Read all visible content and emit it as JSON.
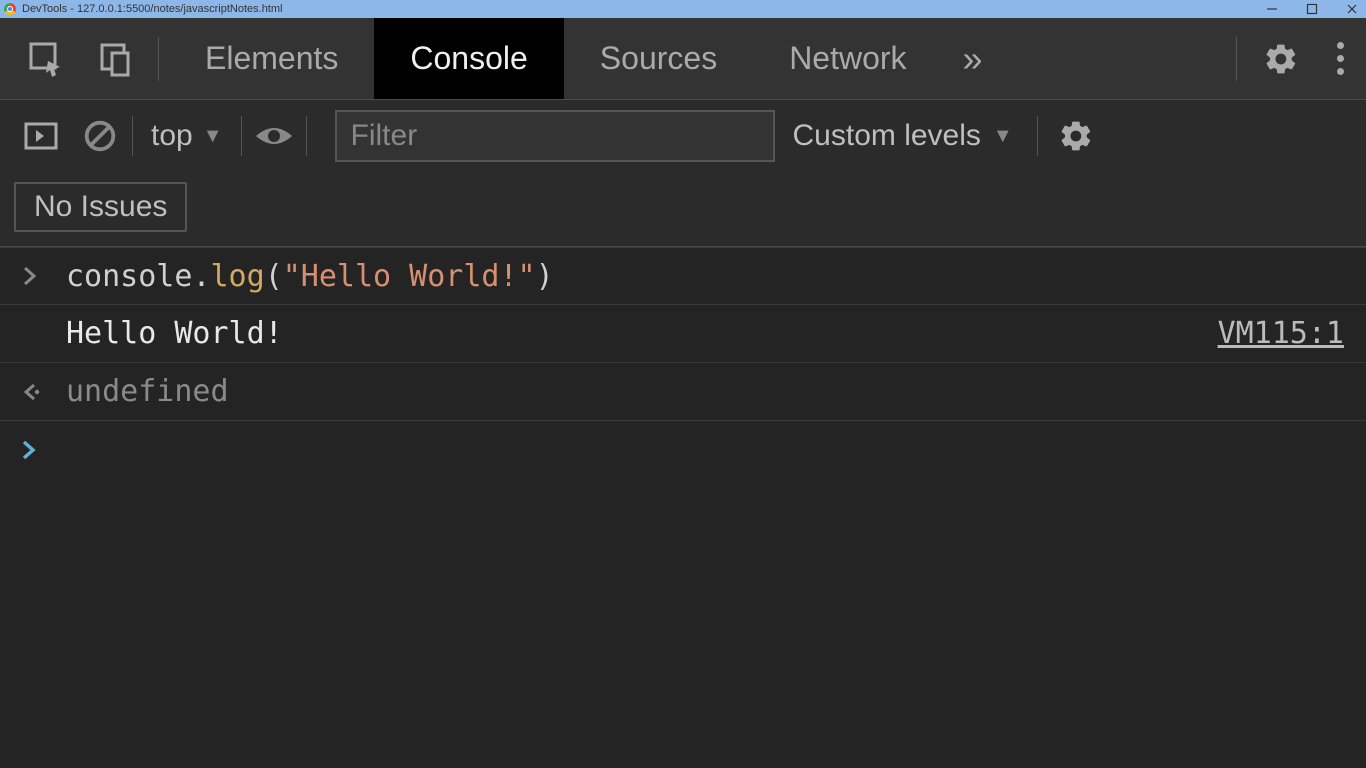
{
  "window": {
    "title": "DevTools - 127.0.0.1:5500/notes/javascriptNotes.html"
  },
  "tabs": {
    "elements": "Elements",
    "console": "Console",
    "sources": "Sources",
    "network": "Network"
  },
  "filterbar": {
    "context": "top",
    "filter_placeholder": "Filter",
    "levels": "Custom levels"
  },
  "issues": {
    "none": "No Issues"
  },
  "console_rows": {
    "input_obj": "console",
    "input_dot": ".",
    "input_method": "log",
    "input_paren_open": "(",
    "input_string": "\"Hello World!\"",
    "input_paren_close": ")",
    "log_output": "Hello World!",
    "log_source": "VM115:1",
    "return_value": "undefined"
  }
}
